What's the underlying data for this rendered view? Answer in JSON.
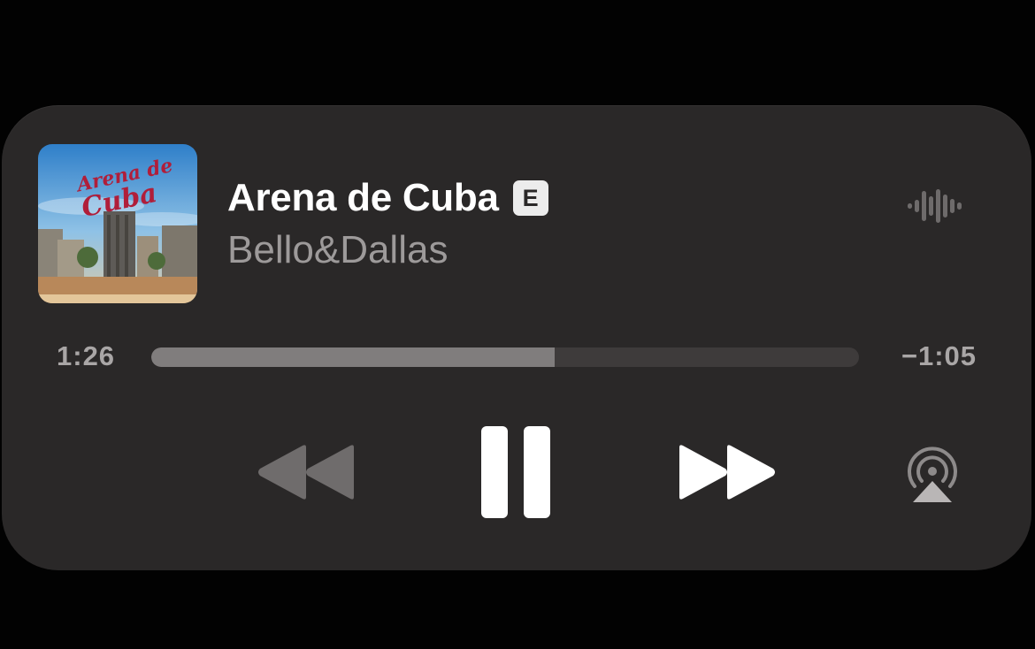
{
  "track": {
    "title": "Arena de Cuba",
    "explicit_badge": "E",
    "artist": "Bello&Dallas"
  },
  "artwork": {
    "text_line1": "Arena de",
    "text_line2": "Cuba"
  },
  "playback": {
    "elapsed": "1:26",
    "remaining": "−1:05",
    "progress_fraction": 0.57,
    "state": "playing"
  },
  "controls": {
    "rewind_icon": "rewind-icon",
    "pause_icon": "pause-icon",
    "forward_icon": "fast-forward-icon",
    "airplay_icon": "airplay-icon",
    "waveform_icon": "waveform-icon"
  },
  "colors": {
    "panel": "#2a2828",
    "title": "#ffffff",
    "artist": "#9d9a9a",
    "progress_fill": "#807d7d",
    "progress_track": "#3e3b3b"
  }
}
